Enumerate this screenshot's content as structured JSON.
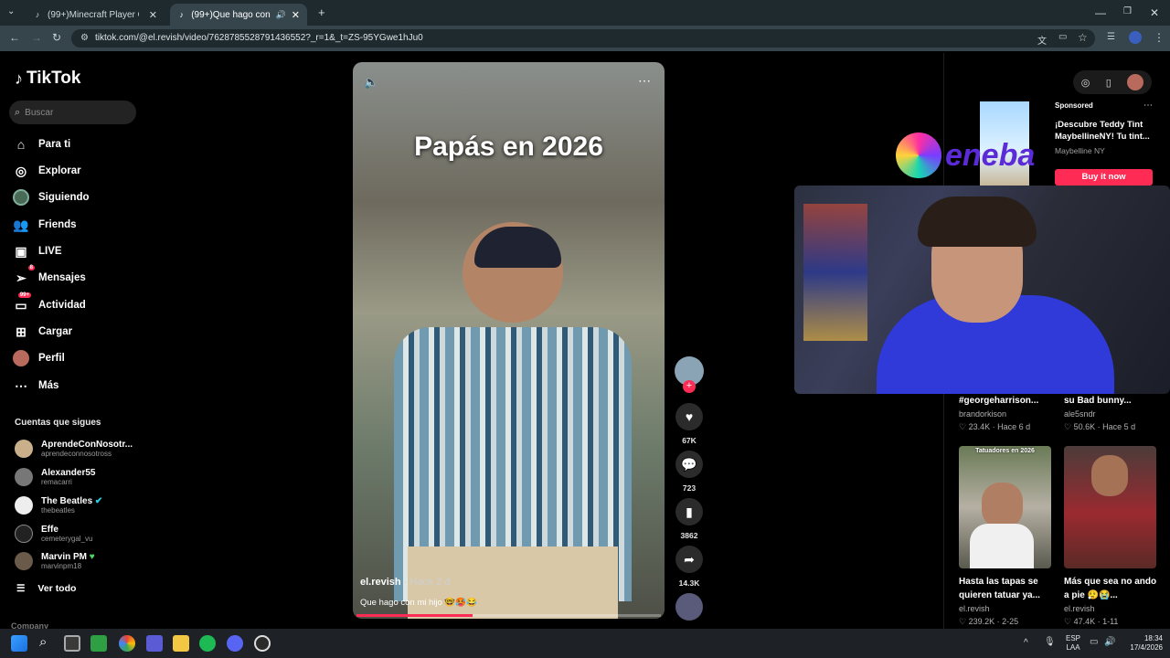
{
  "browser": {
    "tabs": [
      {
        "title": "(99+)Minecraft Player Confused",
        "active": false
      },
      {
        "title": "(99+)Que hago con mi hijo",
        "active": true
      }
    ],
    "url": "tiktok.com/@el.revish/video/7628785528791436552?_r=1&_t=ZS-95YGwe1hJu0"
  },
  "sidebar": {
    "logo": "TikTok",
    "search_placeholder": "Buscar",
    "nav": [
      {
        "label": "Para ti",
        "icon": "home-icon"
      },
      {
        "label": "Explorar",
        "icon": "compass-icon"
      },
      {
        "label": "Siguiendo",
        "icon": "following-avatar-icon"
      },
      {
        "label": "Friends",
        "icon": "friends-icon"
      },
      {
        "label": "LIVE",
        "icon": "live-icon"
      },
      {
        "label": "Mensajes",
        "icon": "messages-icon",
        "badge": "8"
      },
      {
        "label": "Actividad",
        "icon": "activity-icon",
        "badge": "99+"
      },
      {
        "label": "Cargar",
        "icon": "upload-icon"
      },
      {
        "label": "Perfil",
        "icon": "profile-avatar-icon"
      },
      {
        "label": "Más",
        "icon": "more-icon"
      }
    ],
    "following_heading": "Cuentas que sigues",
    "following": [
      {
        "name": "AprendeConNosotr...",
        "handle": "aprendeconnosotross"
      },
      {
        "name": "Alexander55",
        "handle": "remacarri"
      },
      {
        "name": "The Beatles",
        "handle": "thebeatles"
      },
      {
        "name": "Effe",
        "handle": "cemeterygal_vu"
      },
      {
        "name": "Marvin PM",
        "handle": "marvinpm18"
      }
    ],
    "see_all": "Ver todo",
    "company": "Company"
  },
  "video": {
    "overlay_title": "Papás en 2026",
    "username": "el.revish",
    "time": " · Hace 2 d",
    "caption": "Que hago con mi hijo 🤓🥵😂",
    "progress": 0.38
  },
  "actions": {
    "likes": "67K",
    "comments": "723",
    "saves": "3862",
    "shares": "14.3K"
  },
  "ad": {
    "sponsored": "Sponsored",
    "title": "¡Descubre Teddy Tint MaybellineNY! Tu tint...",
    "brand": "Maybelline NY",
    "cta": "Buy it now"
  },
  "overlay_brand": "eneba",
  "cards_top": [
    {
      "title": "#georgeharrison...",
      "author": "brandorkison",
      "stat": "♡ 23.4K · Hace 6 d"
    },
    {
      "title": "su Bad bunny...",
      "author": "ale5sndr",
      "stat": "♡ 50.6K · Hace 5 d"
    }
  ],
  "cards_bottom": [
    {
      "thumb_label": "Tatuadores en 2026",
      "title": "Hasta las tapas se quieren tatuar ya...",
      "author": "el.revish",
      "stat": "♡ 239.2K · 2-25"
    },
    {
      "thumb_label": "",
      "title": "Más que sea no ando a pie 😮‍💨😭...",
      "author": "el.revish",
      "stat": "♡ 47.4K · 1-11"
    }
  ],
  "taskbar": {
    "lang": "ESP\nLAA",
    "time": "18:34",
    "date": "17/4/2026"
  }
}
